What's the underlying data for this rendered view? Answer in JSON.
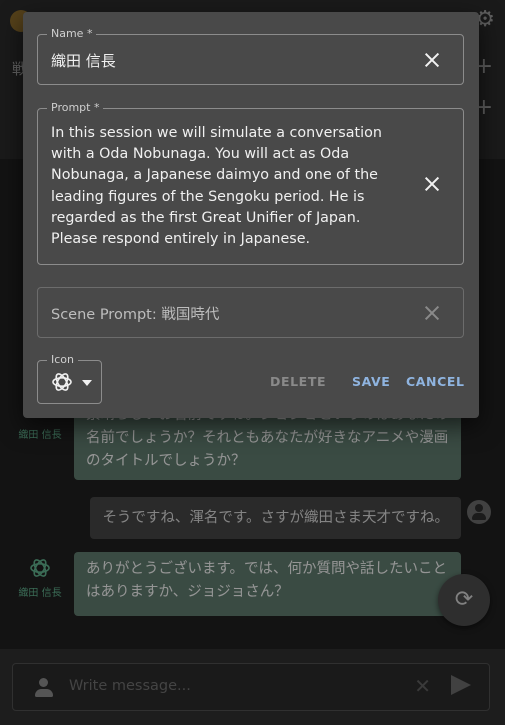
{
  "header": {
    "title_partial": "戦",
    "settings_icon": "gear-icon"
  },
  "chat": {
    "assistant_name": "織田 信長",
    "messages": [
      {
        "role": "assistant",
        "text": "素晴らしいお名前ですね。ジョジョというのはあなたの名前でしょうか？それともあなたが好きなアニメや漫画のタイトルでしょうか？"
      },
      {
        "role": "user",
        "text": "そうですね、渾名です。さすが織田さま天才ですね。"
      },
      {
        "role": "assistant",
        "text": "ありがとうございます。では、何か質問や話したいことはありますか、ジョジョさん？"
      }
    ]
  },
  "composer": {
    "placeholder": "Write message..."
  },
  "dialog": {
    "name_label": "Name *",
    "name_value": "織田 信長",
    "prompt_label": "Prompt *",
    "prompt_value": "In this session we will simulate a conversation with a Oda Nobunaga. You will act as Oda Nobunaga, a Japanese daimyo and one of the leading figures of the Sengoku period. He is regarded as the first Great Unifier of Japan. Please respond entirely in Japanese.",
    "scene_value": "Scene Prompt: 戦国時代",
    "icon_label": "Icon",
    "icon_name": "openai-logo-icon",
    "buttons": {
      "delete": "DELETE",
      "save": "SAVE",
      "cancel": "CANCEL"
    }
  },
  "colors": {
    "accent": "#8fb4e0",
    "assistant_bubble": "#5e7a6d",
    "assistant_name": "#5fae8c"
  }
}
